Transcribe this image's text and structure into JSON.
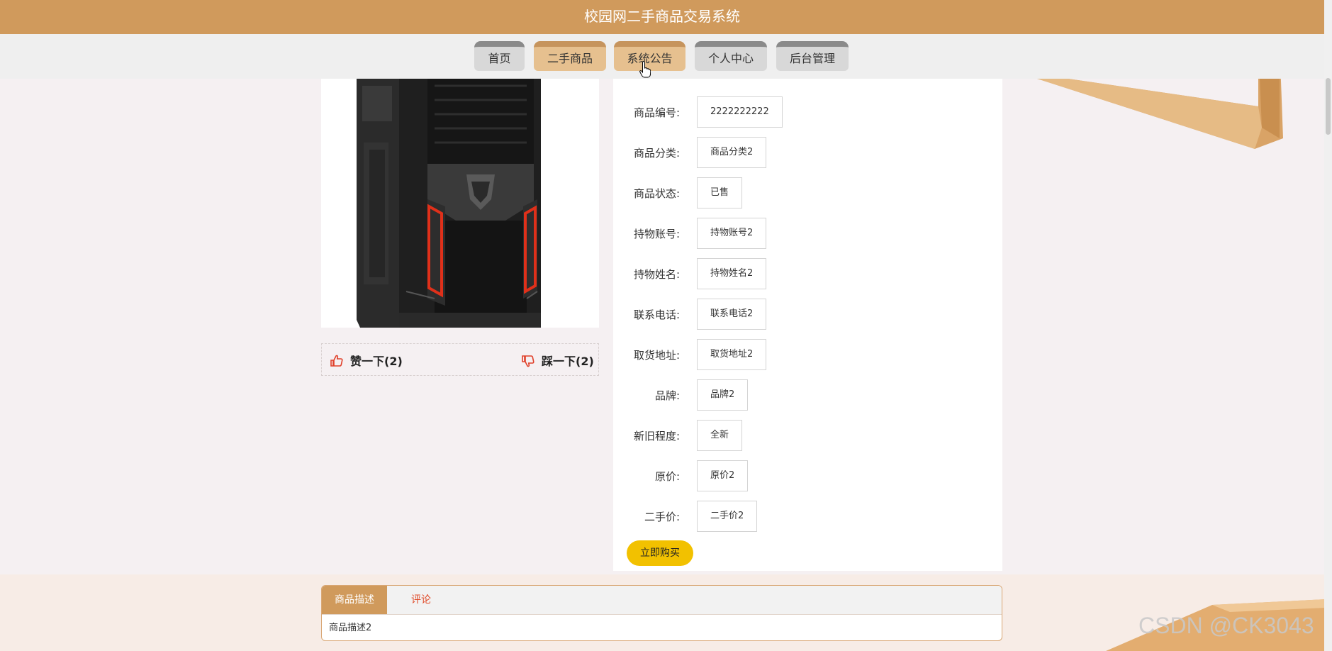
{
  "app": {
    "title": "校园网二手商品交易系统"
  },
  "nav": {
    "items": [
      {
        "label": "首页"
      },
      {
        "label": "二手商品"
      },
      {
        "label": "系统公告"
      },
      {
        "label": "个人中心"
      },
      {
        "label": "后台管理"
      }
    ]
  },
  "votes": {
    "like_label": "赞一下(2)",
    "dislike_label": "踩一下(2)"
  },
  "details": {
    "fields": [
      {
        "label": "商品编号:",
        "value": "2222222222"
      },
      {
        "label": "商品分类:",
        "value": "商品分类2"
      },
      {
        "label": "商品状态:",
        "value": "已售"
      },
      {
        "label": "持物账号:",
        "value": "持物账号2"
      },
      {
        "label": "持物姓名:",
        "value": "持物姓名2"
      },
      {
        "label": "联系电话:",
        "value": "联系电话2"
      },
      {
        "label": "取货地址:",
        "value": "取货地址2"
      },
      {
        "label": "品牌:",
        "value": "品牌2"
      },
      {
        "label": "新旧程度:",
        "value": "全新"
      },
      {
        "label": "原价:",
        "value": "原价2"
      },
      {
        "label": "二手价:",
        "value": "二手价2"
      }
    ],
    "buy_label": "立即购买"
  },
  "tabs": {
    "items": [
      {
        "label": "商品描述"
      },
      {
        "label": "评论"
      }
    ],
    "content": "商品描述2"
  },
  "watermark": "CSDN @CK3043",
  "colors": {
    "brand": "#d09a5c",
    "buy": "#f2c100",
    "tab_inactive_text": "#e04b2a"
  }
}
